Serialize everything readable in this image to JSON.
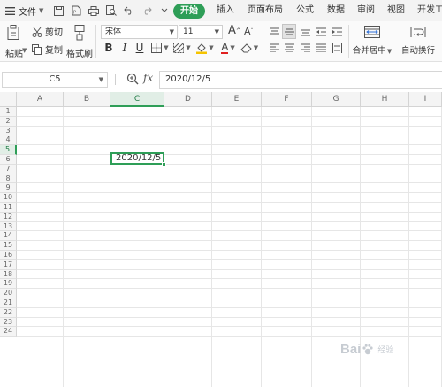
{
  "menu": {
    "file_label": "文件",
    "tabs": [
      {
        "label": "开始",
        "active": true
      },
      {
        "label": "插入"
      },
      {
        "label": "页面布局"
      },
      {
        "label": "公式"
      },
      {
        "label": "数据"
      },
      {
        "label": "审阅"
      },
      {
        "label": "视图"
      },
      {
        "label": "开发工"
      }
    ],
    "accent_color": "#2e9e57"
  },
  "ribbon": {
    "paste_label": "粘贴",
    "cut_label": "剪切",
    "copy_label": "复制",
    "format_painter_label": "格式刷",
    "font_name": "宋体",
    "font_size": "11",
    "bold": "B",
    "italic": "I",
    "underline": "U",
    "font_color_letter": "A",
    "merge_center_label": "合并居中",
    "wrap_text_label": "自动换行"
  },
  "formula_bar": {
    "cell_ref": "C5",
    "fx": "fx",
    "value": "2020/12/5"
  },
  "sheet": {
    "columns": [
      "A",
      "B",
      "C",
      "D",
      "E",
      "F",
      "G",
      "H",
      "I"
    ],
    "rows": [
      "1",
      "2",
      "3",
      "4",
      "5",
      "6",
      "7",
      "8",
      "9",
      "10",
      "11",
      "12",
      "13",
      "14",
      "15",
      "16",
      "17",
      "18",
      "19",
      "20",
      "21",
      "22",
      "23",
      "24"
    ],
    "selected_column": "C",
    "selected_row": "5",
    "active_cell_value": "2020/12/5"
  },
  "watermark": {
    "text": "Bai",
    "sub": "经验"
  }
}
